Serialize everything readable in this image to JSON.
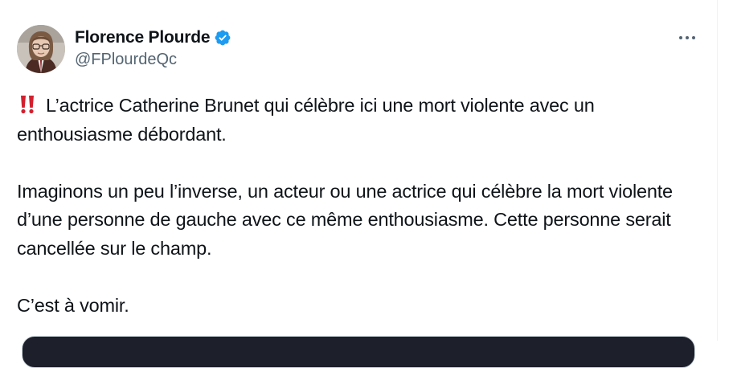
{
  "author": {
    "display_name": "Florence Plourde",
    "handle": "@FPlourdeQc",
    "verified": true,
    "verified_color": "#1d9bf0",
    "avatar_icon": "profile-photo"
  },
  "menu": {
    "icon": "more-horizontal-icon"
  },
  "tweet": {
    "emoji": "double-exclamation-icon",
    "emoji_color": "#d2202f",
    "line1": "L’actrice Catherine Brunet qui célèbre ici une mort violente avec un enthousiasme débordant.",
    "paragraph2": "Imaginons un peu l’inverse, un acteur ou une actrice qui célèbre la mort violente d’une personne de gauche avec ce même enthousiasme. Cette personne serait cancellée sur le champ.",
    "paragraph3": "C’est à vomir."
  },
  "colors": {
    "text": "#0f1419",
    "secondary": "#536471",
    "border": "#eff3f4"
  }
}
